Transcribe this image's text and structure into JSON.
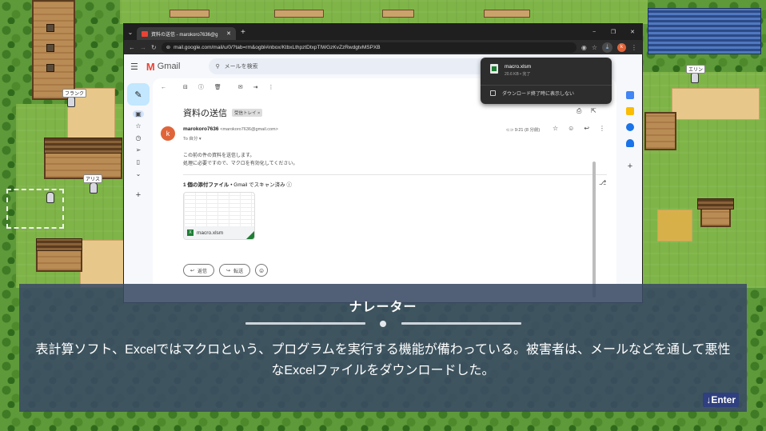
{
  "scene": {
    "npc_names": [
      "フランク",
      "アリス",
      "エリン"
    ]
  },
  "browser": {
    "tab_title": "資料の送信 - marokoro7636@g",
    "new_tab": "+",
    "url": "mail.google.com/mail/u/0/?tab=rm&ogbl#inbox/KtbxLthpztDtxpTlWGzKvZzRwdgtvMSPXB",
    "window_buttons": [
      "−",
      "❐",
      "✕"
    ]
  },
  "gmail": {
    "app_name": "Gmail",
    "search_placeholder": "メールを検索",
    "subject": "資料の送信",
    "label_badge": "受信トレイ ×",
    "sender_name": "marokoro7636",
    "sender_email": "<marokoro7636@gmail.com>",
    "to": "To 自分 ▾",
    "time": "9:21 (8 分前)",
    "body_line1": "この前の件の資料を送信します。",
    "body_line2": "処理に必要ですので、マクロを有効化してください。",
    "attachment_header_bold": "1 個の添付ファイル",
    "attachment_header_rest": " • Gmail でスキャン済み ⓘ",
    "attachment_name": "macro.xlsm",
    "reply_label": "返信",
    "forward_label": "転送",
    "avatar_letter": "k"
  },
  "download": {
    "file_name": "macro.xlsm",
    "file_meta": "20.6 KB • 完了",
    "option_label": "ダウンロード終了時に表示しない"
  },
  "narrator": {
    "speaker": "ナレーター",
    "text": "表計算ソフト、Excelではマクロという、プログラムを実行する機能が備わっている。被害者は、メールなどを通して悪性なExcelファイルをダウンロードした。",
    "continue": "↓Enter"
  },
  "colors": {
    "gmail_red": "#ea4335",
    "avatar": "#e0643a",
    "narrator_bg": "#3a4a64",
    "enter_bg": "#2f3f80"
  }
}
